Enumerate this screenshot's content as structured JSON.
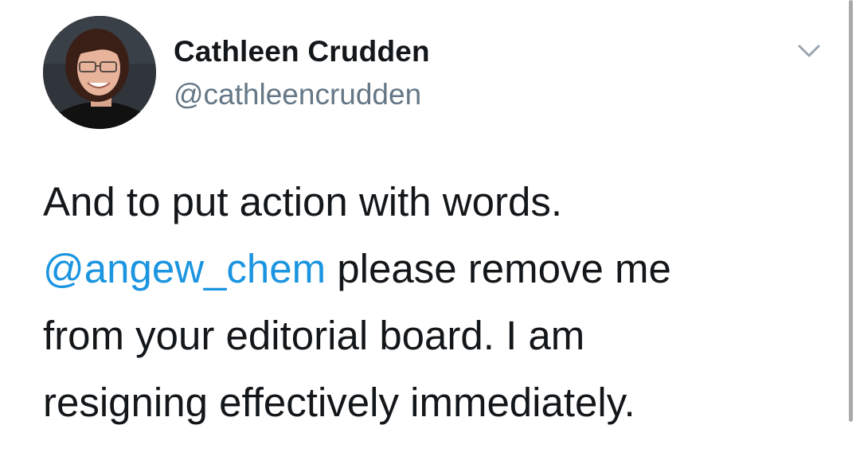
{
  "tweet": {
    "author": {
      "display_name": "Cathleen Crudden",
      "handle": "@cathleencrudden",
      "avatar": "profile-photo"
    },
    "menu_icon": "chevron-down-icon",
    "text_lines": {
      "line1": "And to put action with words.",
      "line2_mention": "@angew_chem",
      "line2_rest": " please remove me",
      "line3": "from your editorial board. I am",
      "line4": "resigning effectively immediately."
    }
  },
  "colors": {
    "text": "#14171a",
    "secondary": "#657786",
    "link": "#1b95e0",
    "background": "#ffffff"
  }
}
